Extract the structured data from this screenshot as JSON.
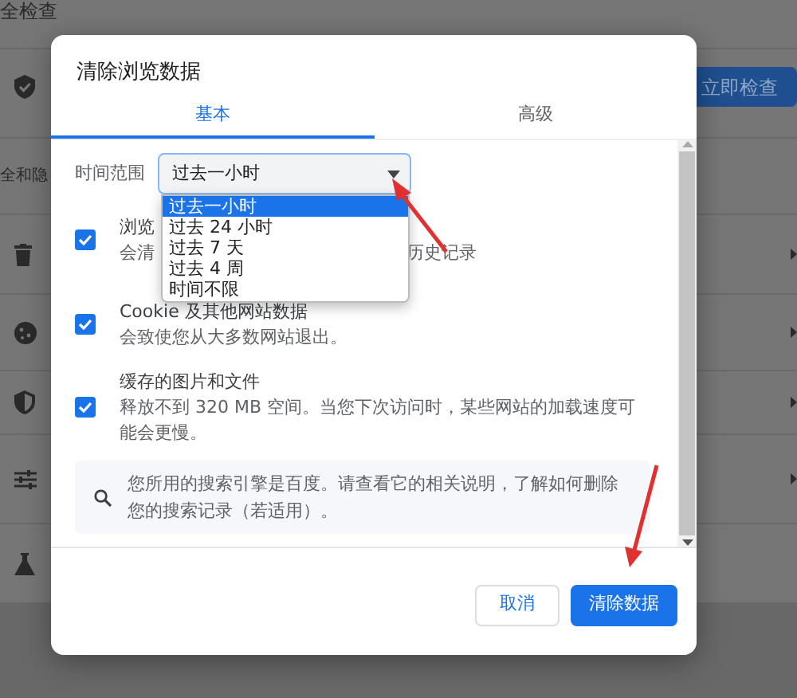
{
  "background": {
    "heading": "全检查",
    "check_button": "立即检查",
    "section_heading": "全和隐"
  },
  "dialog": {
    "title": "清除浏览数据",
    "tabs": [
      {
        "label": "基本",
        "selected": true
      },
      {
        "label": "高级",
        "selected": false
      }
    ],
    "time_range": {
      "label": "时间范围",
      "value": "过去一小时",
      "expanded": true,
      "options": [
        {
          "label": "过去一小时",
          "selected": true
        },
        {
          "label": "过去 24 小时",
          "selected": false
        },
        {
          "label": "过去 7 天",
          "selected": false
        },
        {
          "label": "过去 4 周",
          "selected": false
        },
        {
          "label": "时间不限",
          "selected": false
        }
      ]
    },
    "items": [
      {
        "title": "浏览",
        "description": "会清",
        "description_after": "历史记录",
        "checked": true
      },
      {
        "title": "Cookie 及其他网站数据",
        "description": "会致使您从大多数网站退出。",
        "checked": true
      },
      {
        "title": "缓存的图片和文件",
        "description": "释放不到 320 MB 空间。当您下次访问时，某些网站的加载速度可能会更慢。",
        "checked": true
      }
    ],
    "note": "您所用的搜索引擎是百度。请查看它的相关说明，了解如何删除您的搜索记录（若适用）。",
    "buttons": {
      "cancel": "取消",
      "confirm": "清除数据"
    }
  }
}
